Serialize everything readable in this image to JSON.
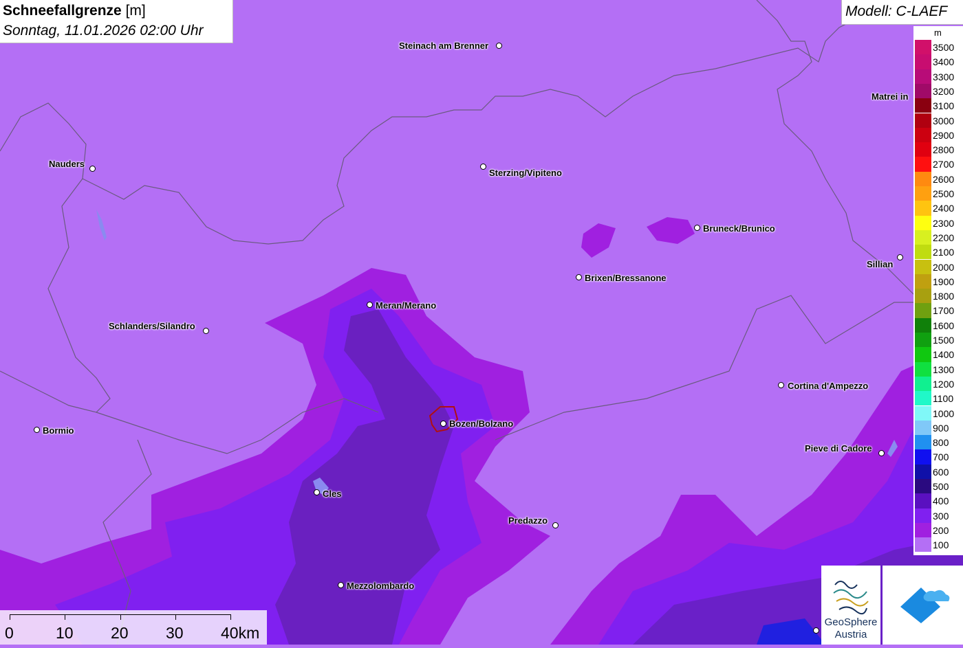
{
  "title": {
    "main": "Schneefallgrenze",
    "unit": "[m]",
    "subtitle": "Sonntag, 11.01.2026 02:00 Uhr"
  },
  "model": "Modell: C-LAEF",
  "legend": {
    "unit": "m",
    "levels": [
      {
        "label": "3500",
        "color": "#d1106a"
      },
      {
        "label": "3400",
        "color": "#c80d70"
      },
      {
        "label": "3300",
        "color": "#b80c78"
      },
      {
        "label": "3200",
        "color": "#a00a68"
      },
      {
        "label": "3100",
        "color": "#8a0010"
      },
      {
        "label": "3000",
        "color": "#b00010"
      },
      {
        "label": "2900",
        "color": "#cc0010"
      },
      {
        "label": "2800",
        "color": "#e00010"
      },
      {
        "label": "2700",
        "color": "#ff1010"
      },
      {
        "label": "2600",
        "color": "#ff8a10"
      },
      {
        "label": "2500",
        "color": "#ffa010"
      },
      {
        "label": "2400",
        "color": "#ffc410"
      },
      {
        "label": "2300",
        "color": "#ffff10"
      },
      {
        "label": "2200",
        "color": "#d8f020"
      },
      {
        "label": "2100",
        "color": "#c0dc10"
      },
      {
        "label": "2000",
        "color": "#c8c010"
      },
      {
        "label": "1900",
        "color": "#c0a010"
      },
      {
        "label": "1800",
        "color": "#a8a010"
      },
      {
        "label": "1700",
        "color": "#70a010"
      },
      {
        "label": "1600",
        "color": "#10800a"
      },
      {
        "label": "1500",
        "color": "#10a010"
      },
      {
        "label": "1400",
        "color": "#10c810"
      },
      {
        "label": "1300",
        "color": "#10e040"
      },
      {
        "label": "1200",
        "color": "#10f090"
      },
      {
        "label": "1100",
        "color": "#20f8c8"
      },
      {
        "label": "1000",
        "color": "#80f8f8"
      },
      {
        "label": "900",
        "color": "#80c8f8"
      },
      {
        "label": "800",
        "color": "#2090f0"
      },
      {
        "label": "700",
        "color": "#1010f0"
      },
      {
        "label": "600",
        "color": "#1010a8"
      },
      {
        "label": "500",
        "color": "#2a0a80"
      },
      {
        "label": "400",
        "color": "#5a10c0"
      },
      {
        "label": "300",
        "color": "#8020f0"
      },
      {
        "label": "200",
        "color": "#a020e0"
      },
      {
        "label": "100",
        "color": "#b46ff5"
      }
    ]
  },
  "cities": [
    {
      "name": "Steinach am Brenner"
    },
    {
      "name": "Nauders"
    },
    {
      "name": "Sterzing/Vipiteno"
    },
    {
      "name": "Matrei in"
    },
    {
      "name": "Bruneck/Brunico"
    },
    {
      "name": "Sillian"
    },
    {
      "name": "Brixen/Bressanone"
    },
    {
      "name": "Meran/Merano"
    },
    {
      "name": "Schlanders/Silandro"
    },
    {
      "name": "Cortina d'Ampezzo"
    },
    {
      "name": "Bormio"
    },
    {
      "name": "Bozen/Bolzano"
    },
    {
      "name": "Pieve di Cadore"
    },
    {
      "name": "Cles"
    },
    {
      "name": "Predazzo"
    },
    {
      "name": "Mezzolombardo"
    }
  ],
  "scale": {
    "labels": [
      "0",
      "10",
      "20",
      "30",
      "40km"
    ]
  },
  "logo": {
    "line1": "GeoSphere",
    "line2": "Austria"
  }
}
